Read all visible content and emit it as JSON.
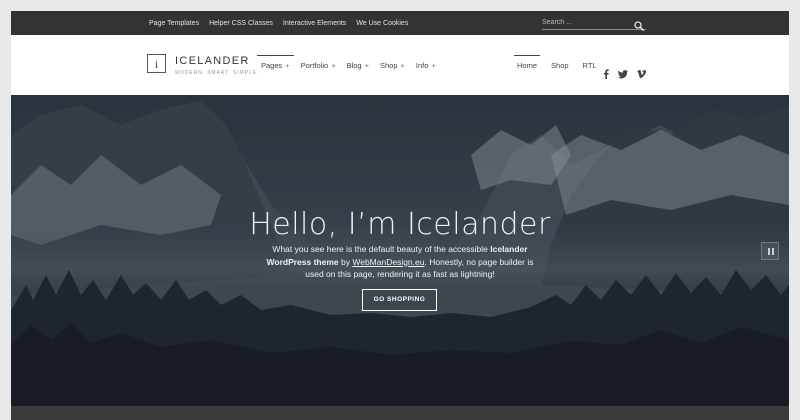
{
  "topbar": {
    "links": [
      "Page Templates",
      "Helper CSS Classes",
      "Interactive Elements",
      "We Use Cookies"
    ],
    "search_placeholder": "Search ...",
    "search_icon": "search-icon"
  },
  "brand": {
    "logo_letter": "i",
    "name": "ICELANDER",
    "tagline": "MODERN. SMART. SIMPLE."
  },
  "main_nav": {
    "items": [
      {
        "label": "Pages",
        "plus": "+"
      },
      {
        "label": "Portfolio",
        "plus": "+"
      },
      {
        "label": "Blog",
        "plus": "+"
      },
      {
        "label": "Shop",
        "plus": "+"
      },
      {
        "label": "Info",
        "plus": "+"
      }
    ]
  },
  "secondary_nav": {
    "items": [
      "Home",
      "Shop",
      "RTL"
    ]
  },
  "social": {
    "icons": [
      "facebook-icon",
      "twitter-icon",
      "vimeo-icon"
    ]
  },
  "hero": {
    "title": "Hello, I’m Icelander",
    "text_1": "What you see here is the default beauty of the accessible ",
    "text_bold": "Icelander WordPress theme",
    "text_2": " by ",
    "text_link": "WebManDesign.eu",
    "text_3": ". Honestly, no page builder is used on this page, rendering it as fast as lightning!",
    "cta_label": "GO SHOPPING",
    "pause_icon": "pause-icon"
  },
  "colors": {
    "topbar_bg": "#333333",
    "page_bg": "#e9e9e9",
    "hero_overlay": "#2e3a44"
  }
}
